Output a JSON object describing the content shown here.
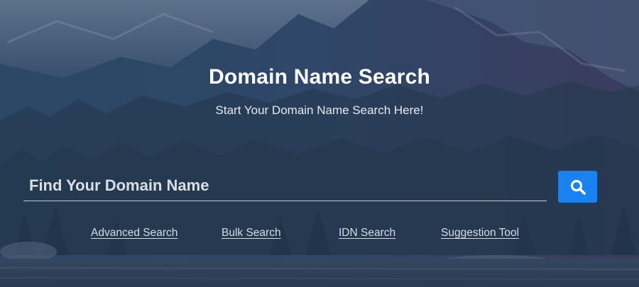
{
  "hero": {
    "title": "Domain Name Search",
    "subtitle": "Start Your Domain Name Search Here!"
  },
  "search": {
    "placeholder": "Find Your Domain Name",
    "value": "",
    "button_icon": "search-icon"
  },
  "links": {
    "advanced": "Advanced Search",
    "bulk": "Bulk Search",
    "idn": "IDN Search",
    "suggestion": "Suggestion Tool"
  },
  "colors": {
    "button": "#1a82f0",
    "overlay": "#2b4463",
    "text": "#ffffff"
  }
}
